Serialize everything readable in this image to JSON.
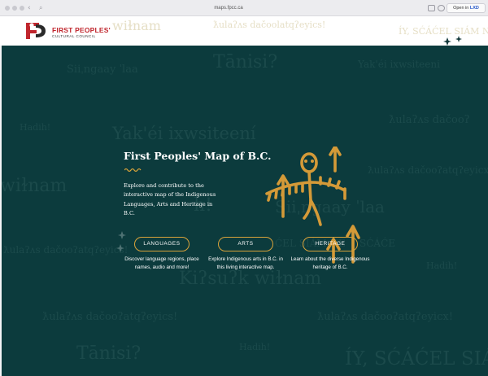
{
  "browser": {
    "url": "maps.fpcc.ca",
    "open_in_label": "Open in",
    "open_in_app": "LXD"
  },
  "logo": {
    "line1": "FIRST PEOPLES'",
    "line2": "CULTURAL COUNCIL"
  },
  "header_words": [
    "wiɫnam",
    "ƛulaʔʌs dačoolatqʔeyics!",
    "ÍY, SĆÁĆEL SIÁM NE"
  ],
  "background_words": [
    "Tānisi?",
    "Siiˌngaay ˈlaa",
    "Yak'éi ixwsiteeni",
    "Hadih!",
    "Yak'éi ixwsiteení",
    "ƛulaʔʌs dačooʔ",
    "wiɫnam",
    "h!",
    "Siiˌngaay ˈlaa",
    "ƛulaʔʌs dačooʔatqʔeyics!",
    "ƛulaʔʌs dačooʔatqʔeyicx!",
    "ĆEL SIÁM NE",
    "SĆÁĆE",
    "Hadih!",
    "Kiʔsuʔk wiɫnam",
    "ƛulaʔʌs dačooʔatqʔeyics!",
    "ƛulaʔʌs dačooʔatqʔeyicx!",
    "Hadih!",
    "Tānisi?",
    "ÍY, SĆÁĆEL SIÁM"
  ],
  "hero": {
    "title": "First Peoples' Map of B.C.",
    "intro": "Explore and contribute to the interactive map of the Indigenous Languages, Arts and Heritage in B.C."
  },
  "sections": [
    {
      "label": "LANGUAGES",
      "desc": "Discover language regions, place names, audio and more!"
    },
    {
      "label": "ARTS",
      "desc": "Explore Indigenous arts in B.C. in this living interactive map."
    },
    {
      "label": "HERITAGE",
      "desc": "Learn about the diverse Indigenous heritage of B.C."
    }
  ],
  "colors": {
    "hero_bg": "#0c3b3d",
    "accent_gold": "#d9a33a",
    "brand_red": "#c0262d"
  },
  "icons": {
    "back": "chevron-left-icon",
    "forward": "chevron-right-icon",
    "search": "search-icon",
    "artwork": "petroglyph-figure-icon",
    "decoration": "sparkle-stars-icon"
  }
}
